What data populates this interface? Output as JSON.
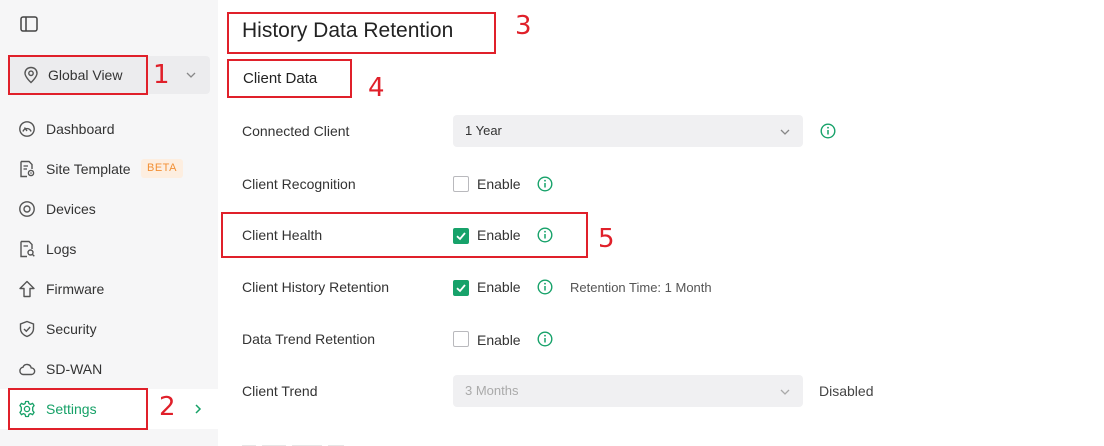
{
  "sidebar": {
    "site_selector": {
      "label": "Global View"
    },
    "items": [
      {
        "label": "Dashboard"
      },
      {
        "label": "Site Template",
        "badge": "BETA"
      },
      {
        "label": "Devices"
      },
      {
        "label": "Logs"
      },
      {
        "label": "Firmware"
      },
      {
        "label": "Security"
      },
      {
        "label": "SD-WAN"
      },
      {
        "label": "Settings",
        "active": true
      }
    ]
  },
  "main": {
    "title": "History Data Retention",
    "section": "Client Data",
    "rows": {
      "connected_client": {
        "label": "Connected Client",
        "value": "1 Year"
      },
      "client_recognition": {
        "label": "Client Recognition",
        "checkbox_label": "Enable",
        "checked": false
      },
      "client_health": {
        "label": "Client Health",
        "checkbox_label": "Enable",
        "checked": true
      },
      "client_history_retention": {
        "label": "Client History Retention",
        "checkbox_label": "Enable",
        "checked": true,
        "note": "Retention Time: 1 Month"
      },
      "data_trend_retention": {
        "label": "Data Trend Retention",
        "checkbox_label": "Enable",
        "checked": false
      },
      "client_trend": {
        "label": "Client Trend",
        "value": "3 Months",
        "status": "Disabled"
      }
    }
  },
  "annotations": [
    "1",
    "2",
    "3",
    "4",
    "5"
  ],
  "colors": {
    "accent": "#17a26a",
    "annotation": "#e0202a",
    "badge": "#f29035"
  }
}
